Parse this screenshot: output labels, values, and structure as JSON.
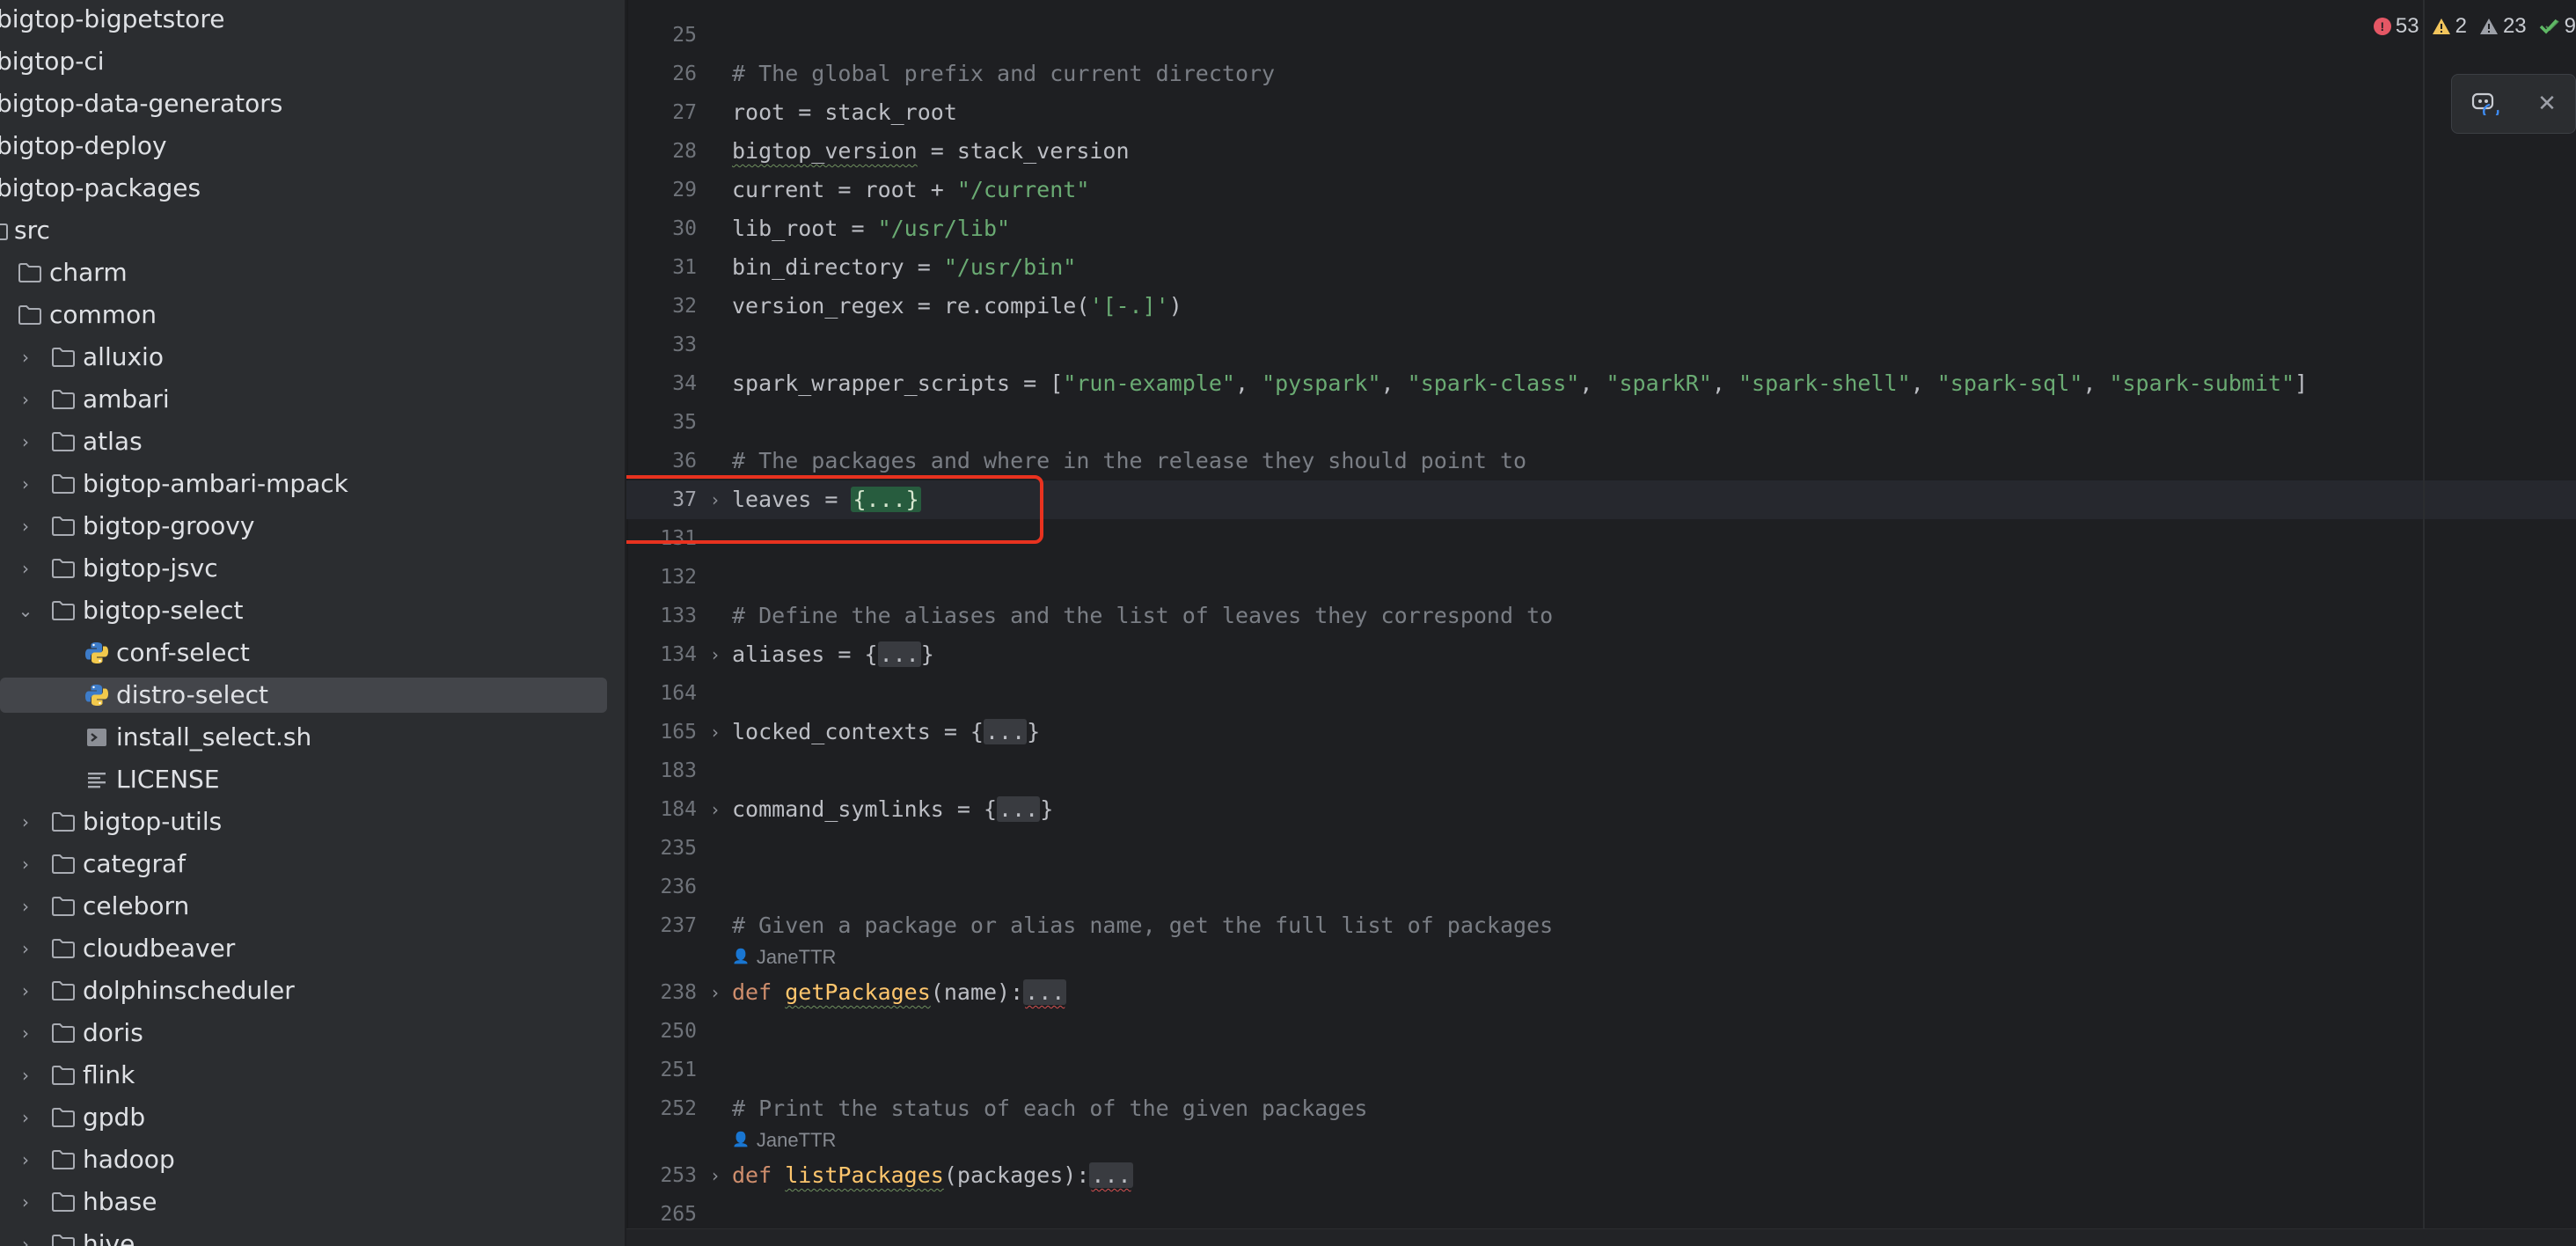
{
  "tree": {
    "items": [
      {
        "label": "bigtop-bigpetstore",
        "icon": "folder-icon",
        "chev": ""
      },
      {
        "label": "bigtop-ci",
        "icon": "folder-icon",
        "chev": ""
      },
      {
        "label": "bigtop-data-generators",
        "icon": "folder-icon",
        "chev": ""
      },
      {
        "label": "bigtop-deploy",
        "icon": "folder-icon",
        "chev": ""
      },
      {
        "label": "bigtop-packages",
        "icon": "folder-icon",
        "chev": ""
      },
      {
        "label": "src",
        "icon": "folder-icon",
        "chev": ""
      },
      {
        "label": "charm",
        "icon": "folder-icon",
        "chev": ""
      },
      {
        "label": "common",
        "icon": "folder-icon",
        "chev": ""
      },
      {
        "label": "alluxio",
        "icon": "folder-icon",
        "chev": "›"
      },
      {
        "label": "ambari",
        "icon": "folder-icon",
        "chev": "›"
      },
      {
        "label": "atlas",
        "icon": "folder-icon",
        "chev": "›"
      },
      {
        "label": "bigtop-ambari-mpack",
        "icon": "folder-icon",
        "chev": "›"
      },
      {
        "label": "bigtop-groovy",
        "icon": "folder-icon",
        "chev": "›"
      },
      {
        "label": "bigtop-jsvc",
        "icon": "folder-icon",
        "chev": "›"
      },
      {
        "label": "bigtop-select",
        "icon": "folder-icon",
        "chev": "⌄"
      },
      {
        "label": "conf-select",
        "icon": "python-file-icon",
        "chev": ""
      },
      {
        "label": "distro-select",
        "icon": "python-file-icon",
        "chev": ""
      },
      {
        "label": "install_select.sh",
        "icon": "shell-script-icon",
        "chev": ""
      },
      {
        "label": "LICENSE",
        "icon": "text-file-icon",
        "chev": ""
      },
      {
        "label": "bigtop-utils",
        "icon": "folder-icon",
        "chev": "›"
      },
      {
        "label": "categraf",
        "icon": "folder-icon",
        "chev": "›"
      },
      {
        "label": "celeborn",
        "icon": "folder-icon",
        "chev": "›"
      },
      {
        "label": "cloudbeaver",
        "icon": "folder-icon",
        "chev": "›"
      },
      {
        "label": "dolphinscheduler",
        "icon": "folder-icon",
        "chev": "›"
      },
      {
        "label": "doris",
        "icon": "folder-icon",
        "chev": "›"
      },
      {
        "label": "flink",
        "icon": "folder-icon",
        "chev": "›"
      },
      {
        "label": "gpdb",
        "icon": "folder-icon",
        "chev": "›"
      },
      {
        "label": "hadoop",
        "icon": "folder-icon",
        "chev": "›"
      },
      {
        "label": "hbase",
        "icon": "folder-icon",
        "chev": "›"
      },
      {
        "label": "hive",
        "icon": "folder-icon",
        "chev": "›"
      }
    ],
    "selected": "distro-select"
  },
  "editor": {
    "lines": [
      {
        "n": "25",
        "t": "",
        "author": ""
      },
      {
        "n": "26",
        "t": "# The global prefix and current directory",
        "author": ""
      },
      {
        "n": "27",
        "t": "root = stack_root",
        "author": ""
      },
      {
        "n": "28",
        "t": "bigtop_version = stack_version",
        "author": ""
      },
      {
        "n": "29",
        "t": "current = root + \"/current\"",
        "author": ""
      },
      {
        "n": "30",
        "t": "lib_root = \"/usr/lib\"",
        "author": ""
      },
      {
        "n": "31",
        "t": "bin_directory = \"/usr/bin\"",
        "author": ""
      },
      {
        "n": "32",
        "t": "version_regex = re.compile('[-.]')",
        "author": ""
      },
      {
        "n": "33",
        "t": "",
        "author": ""
      },
      {
        "n": "34",
        "t": "spark_wrapper_scripts = [\"run-example\", \"pyspark\", \"spark-class\", \"sparkR\", \"spark-shell\", \"spark-sql\", \"spark-submit\"]",
        "author": ""
      },
      {
        "n": "35",
        "t": "",
        "author": ""
      },
      {
        "n": "36",
        "t": "# The packages and where in the release they should point to",
        "author": ""
      },
      {
        "n": "37",
        "t": "leaves = {...}",
        "author": ""
      },
      {
        "n": "131",
        "t": "",
        "author": ""
      },
      {
        "n": "132",
        "t": "",
        "author": ""
      },
      {
        "n": "133",
        "t": "# Define the aliases and the list of leaves they correspond to",
        "author": ""
      },
      {
        "n": "134",
        "t": "aliases = {...}",
        "author": ""
      },
      {
        "n": "164",
        "t": "",
        "author": ""
      },
      {
        "n": "165",
        "t": "locked_contexts = {...}",
        "author": ""
      },
      {
        "n": "183",
        "t": "",
        "author": ""
      },
      {
        "n": "184",
        "t": "command_symlinks = {...}",
        "author": ""
      },
      {
        "n": "235",
        "t": "",
        "author": ""
      },
      {
        "n": "236",
        "t": "",
        "author": ""
      },
      {
        "n": "237",
        "t": "# Given a package or alias name, get the full list of packages",
        "author": "JaneTTR"
      },
      {
        "n": "238",
        "t": "def getPackages(name):...",
        "author": ""
      },
      {
        "n": "250",
        "t": "",
        "author": ""
      },
      {
        "n": "251",
        "t": "",
        "author": ""
      },
      {
        "n": "252",
        "t": "# Print the status of each of the given packages",
        "author": "JaneTTR"
      },
      {
        "n": "253",
        "t": "def listPackages(packages):...",
        "author": ""
      },
      {
        "n": "265",
        "t": "",
        "author": ""
      }
    ],
    "active_line": "37"
  },
  "status": {
    "errors": "53",
    "warnings": "2",
    "weak_warnings": "23",
    "ok": "9"
  },
  "colors": {
    "error": "#e55765",
    "warning": "#f2c55c",
    "weak": "#9da0a8",
    "ok": "#5fb865",
    "highlight_box": "#e8321f"
  }
}
